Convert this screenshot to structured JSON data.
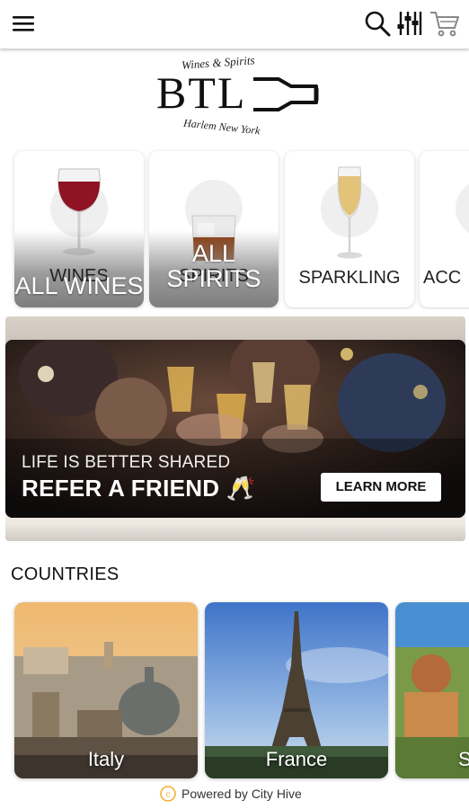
{
  "header": {
    "icons": [
      "menu-icon",
      "search-icon",
      "filter-icon",
      "cart-icon"
    ]
  },
  "logo": {
    "top_text": "Wines & Spirits",
    "main_text": "BTL",
    "bottom_text": "Harlem  New York"
  },
  "categories": [
    {
      "label": "WINES",
      "overlay": "ALL WINES",
      "style": "highlighted"
    },
    {
      "label": "SPIRITS",
      "overlay": "ALL SPIRITS",
      "style": "highlighted"
    },
    {
      "label": "SPARKLING",
      "style": "plain"
    },
    {
      "label": "ACC",
      "style": "plain"
    }
  ],
  "banner": {
    "kicker": "LIFE IS BETTER SHARED",
    "title": "REFER A FRIEND 🥂",
    "button": "LEARN MORE"
  },
  "countries": {
    "title": "COUNTRIES",
    "items": [
      {
        "name": "Italy"
      },
      {
        "name": "France"
      },
      {
        "name": "S"
      }
    ]
  },
  "footer": {
    "powered_by": "Powered by City Hive"
  },
  "colors": {
    "accent": "#f2b233",
    "text": "#111111",
    "card_fade": "#7d7d7d"
  }
}
